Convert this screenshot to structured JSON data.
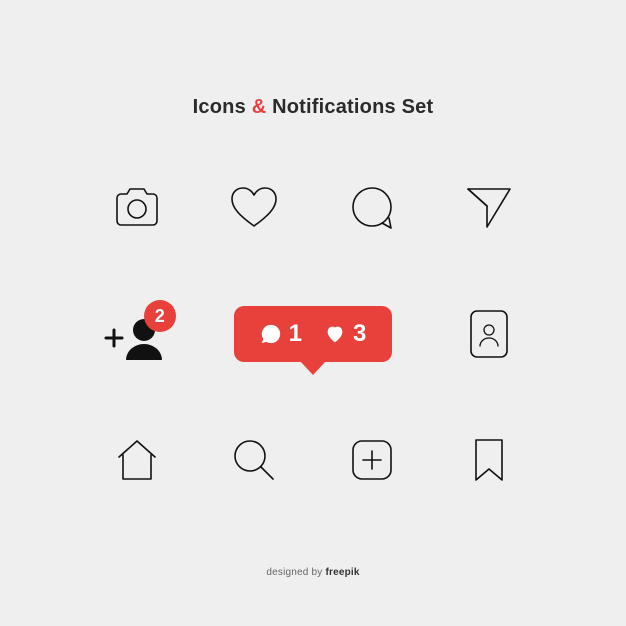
{
  "title": {
    "part1": "Icons",
    "amp": "&",
    "part2": "Notifications Set"
  },
  "badges": {
    "follow_count": "2",
    "bubble_comments": "1",
    "bubble_likes": "3"
  },
  "credit": {
    "prefix": "designed by ",
    "brand": "freepik"
  },
  "colors": {
    "accent": "#e8413c",
    "bg": "#efefef",
    "ink": "#111"
  },
  "icons": {
    "row1": [
      "camera-icon",
      "heart-icon",
      "comment-icon",
      "send-icon"
    ],
    "row2": [
      "add-follower-notification",
      "activity-bubble-notification",
      "contact-card-icon"
    ],
    "row3": [
      "home-icon",
      "search-icon",
      "add-post-icon",
      "bookmark-icon"
    ]
  }
}
